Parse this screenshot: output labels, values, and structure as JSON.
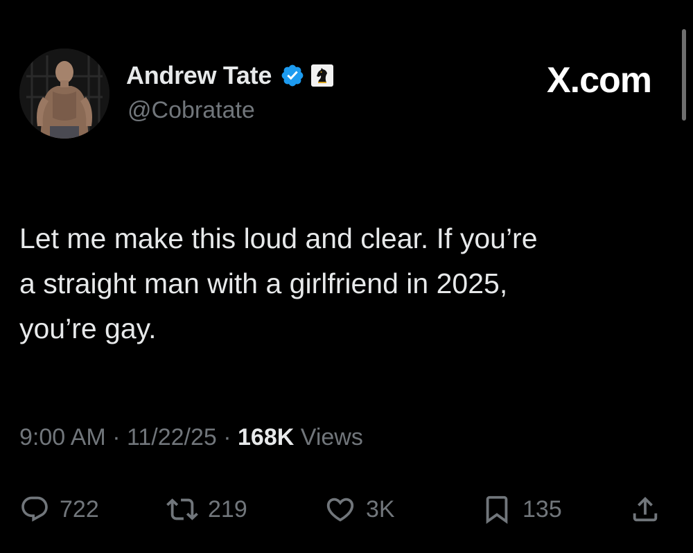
{
  "author": {
    "display_name": "Andrew Tate",
    "handle": "@Cobratate",
    "verified": true
  },
  "brand": "X.com",
  "tweet": {
    "lines": [
      "Let me make this loud and clear. If you’re",
      "a straight man with a girlfriend in 2025,",
      "you’re gay."
    ]
  },
  "meta": {
    "time": "9:00 AM",
    "separator": " · ",
    "date": "11/22/25",
    "views_count": "168K",
    "views_label": "Views"
  },
  "actions": {
    "replies": "722",
    "reposts": "219",
    "likes": "3K",
    "bookmarks": "135"
  },
  "colors": {
    "background": "#000000",
    "text": "#e7e9ea",
    "secondary": "#71767b",
    "verified": "#1d9bf0",
    "affiliate_gold": "#d9a520"
  },
  "icons": {
    "verified": "verified-badge-icon",
    "affiliate": "chess-knight-icon",
    "reply": "speech-bubble-icon",
    "repost": "repost-arrows-icon",
    "like": "heart-icon",
    "bookmark": "bookmark-icon",
    "share": "share-upload-icon"
  }
}
